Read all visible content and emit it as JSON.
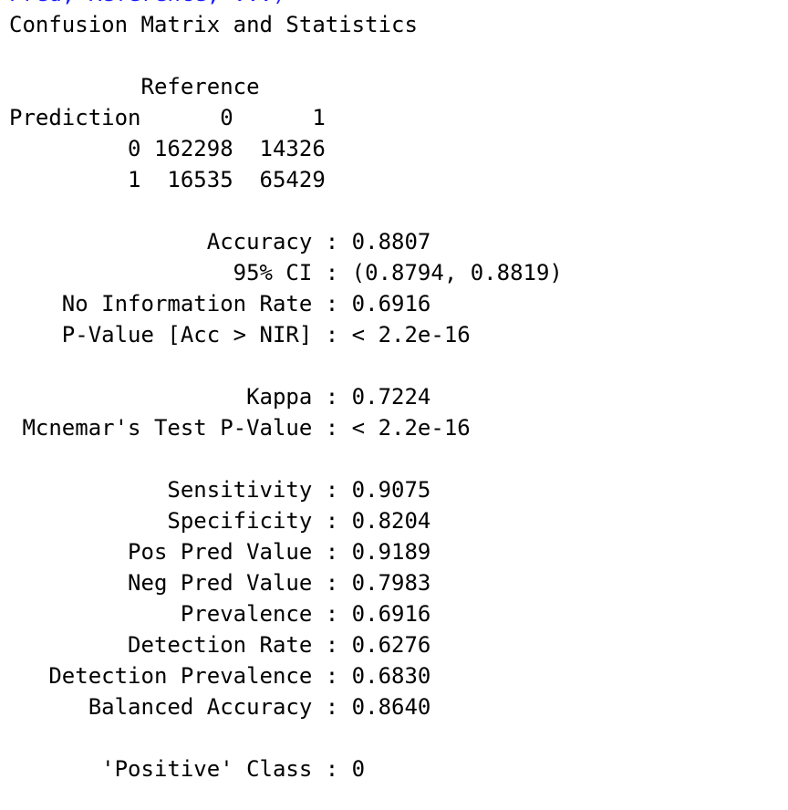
{
  "console": {
    "command_fragment": "Pred, Reference, ...)",
    "title": "Confusion Matrix and Statistics",
    "matrix": {
      "reference_header": "          Reference",
      "prediction_header": "Prediction      0      1",
      "row_0": "         0 162298  14326",
      "row_1": "         1  16535  65429"
    },
    "overall": {
      "accuracy": "               Accuracy : 0.8807",
      "ci": "                 95% CI : (0.8794, 0.8819)",
      "nir": "    No Information Rate : 0.6916",
      "pvalue": "    P-Value [Acc > NIR] : < 2.2e-16"
    },
    "kappa_block": {
      "kappa": "                  Kappa : 0.7224",
      "mcnemar": " Mcnemar's Test P-Value : < 2.2e-16"
    },
    "class_stats": {
      "sensitivity": "            Sensitivity : 0.9075",
      "specificity": "            Specificity : 0.8204",
      "pos_pred": "         Pos Pred Value : 0.9189",
      "neg_pred": "         Neg Pred Value : 0.7983",
      "prevalence": "             Prevalence : 0.6916",
      "detection_rate": "         Detection Rate : 0.6276",
      "detection_prevalence": "   Detection Prevalence : 0.6830",
      "balanced_accuracy": "      Balanced Accuracy : 0.8640"
    },
    "positive_class": "       'Positive' Class : 0"
  }
}
